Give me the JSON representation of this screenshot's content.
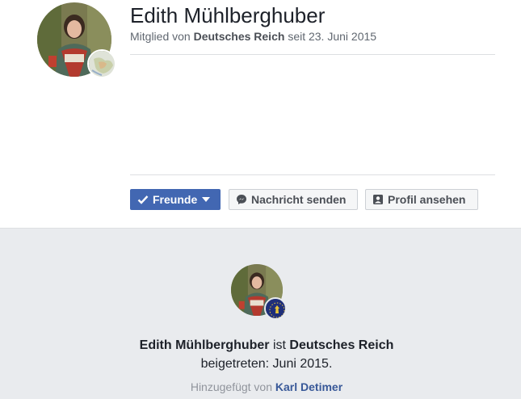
{
  "profile": {
    "name": "Edith Mühlberghuber",
    "member_prefix": "Mitglied von",
    "group_name": "Deutsches Reich",
    "since_text": "seit 23. Juni 2015"
  },
  "actions": {
    "friends_label": "Freunde",
    "message_label": "Nachricht senden",
    "view_profile_label": "Profil ansehen"
  },
  "joined": {
    "name": "Edith Mühlberghuber",
    "is_text": "ist",
    "group_name": "Deutsches Reich",
    "line2": "beigetreten: Juni 2015.",
    "added_prefix": "Hinzugefügt von",
    "added_by": "Karl Detimer"
  },
  "colors": {
    "primary": "#4267b2",
    "link": "#385898",
    "bg_gray": "#e9ebee"
  },
  "icons": [
    "check-icon",
    "caret-down-icon",
    "messenger-icon",
    "profile-card-icon"
  ]
}
